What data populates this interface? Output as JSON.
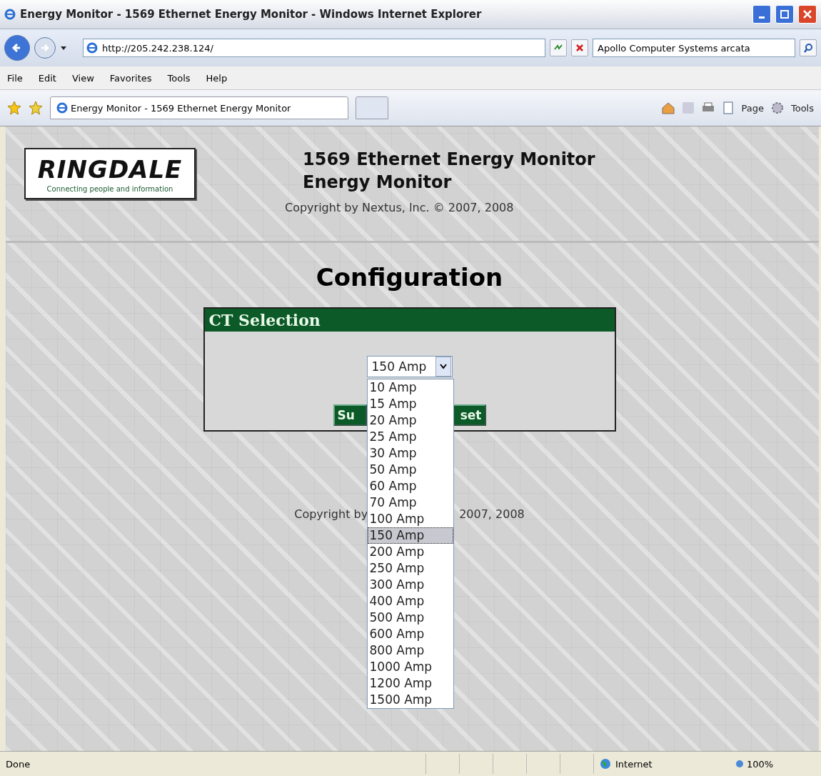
{
  "window": {
    "title": "Energy Monitor - 1569 Ethernet Energy Monitor - Windows Internet Explorer"
  },
  "address_bar": {
    "url": "http://205.242.238.124/"
  },
  "search": {
    "value": "Apollo Computer Systems arcata"
  },
  "menu": [
    "File",
    "Edit",
    "View",
    "Favorites",
    "Tools",
    "Help"
  ],
  "tabs": [
    {
      "label": "Energy Monitor - 1569 Ethernet Energy Monitor",
      "selected": true
    },
    {
      "selected": false
    }
  ],
  "command_bar": [
    "Page",
    "Tools"
  ],
  "header": {
    "logo": "RINGDALE",
    "tagline": "Connecting people and information",
    "title": "1569 Ethernet Energy Monitor",
    "subtitle": "Energy Monitor",
    "copyright": "Copyright by Nextus, Inc. © 2007, 2008"
  },
  "page_title": "Configuration",
  "panel": {
    "title": "CT Selection",
    "select": {
      "value": "150 Amp",
      "expanded": true,
      "options": [
        {
          "label": "10 Amp",
          "selected": false
        },
        {
          "label": "15 Amp",
          "selected": false
        },
        {
          "label": "20 Amp",
          "selected": false
        },
        {
          "label": "25 Amp",
          "selected": false
        },
        {
          "label": "30 Amp",
          "selected": false
        },
        {
          "label": "50 Amp",
          "selected": false
        },
        {
          "label": "60 Amp",
          "selected": false
        },
        {
          "label": "70 Amp",
          "selected": false
        },
        {
          "label": "100 Amp",
          "selected": false
        },
        {
          "label": "150 Amp",
          "selected": true
        },
        {
          "label": "200 Amp",
          "selected": false
        },
        {
          "label": "250 Amp",
          "selected": false
        },
        {
          "label": "300 Amp",
          "selected": false
        },
        {
          "label": "400 Amp",
          "selected": false
        },
        {
          "label": "500 Amp",
          "selected": false
        },
        {
          "label": "600 Amp",
          "selected": false
        },
        {
          "label": "800 Amp",
          "selected": false
        },
        {
          "label": "1000 Amp",
          "selected": false
        },
        {
          "label": "1200 Amp",
          "selected": false
        },
        {
          "label": "1500 Amp",
          "selected": false
        }
      ]
    },
    "buttons": [
      "Su",
      "set"
    ]
  },
  "footer": [
    "Copyright by",
    "2007, 2008"
  ],
  "status_bar": {
    "text": "Done",
    "zone": "Internet",
    "zoom": "100%"
  }
}
